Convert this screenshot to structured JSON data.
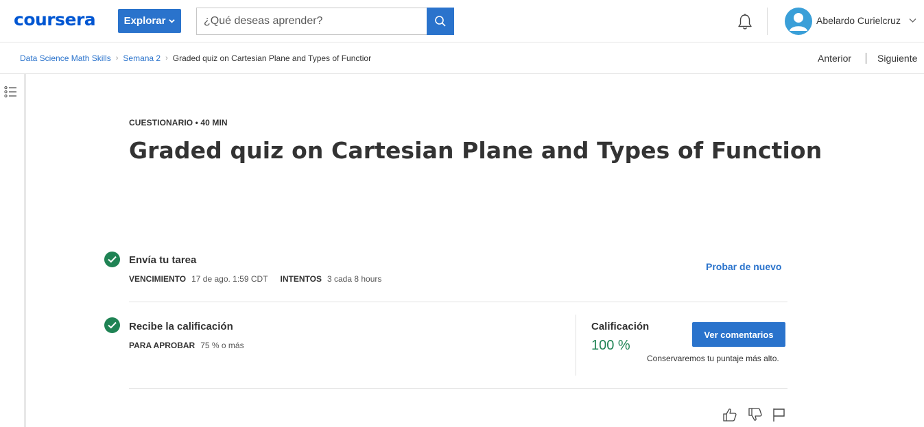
{
  "header": {
    "logo": "coursera",
    "explore_label": "Explorar",
    "search_placeholder": "¿Qué deseas aprender?",
    "user_name": "Abelardo Curielcruz",
    "icons": [
      "chevron-down-icon",
      "search-icon",
      "bell-icon",
      "avatar-user-icon"
    ]
  },
  "breadcrumb": {
    "items": [
      "Data Science Math Skills",
      "Semana 2",
      "Graded quiz on Cartesian Plane and Types of Functior"
    ],
    "separator": "›"
  },
  "nav": {
    "prev": "Anterior",
    "next": "Siguiente"
  },
  "quiz": {
    "kicker": "CUESTIONARIO • 40 MIN",
    "title": "Graded quiz on Cartesian Plane and Types of Function"
  },
  "submit": {
    "title": "Envía tu tarea",
    "due_label": "VENCIMIENTO",
    "due_value": "17 de ago. 1:59 CDT",
    "attempts_label": "INTENTOS",
    "attempts_value": "3 cada 8 hours",
    "retry": "Probar de nuevo"
  },
  "grade": {
    "title": "Recibe la calificación",
    "pass_label": "PARA APROBAR",
    "pass_value": "75 % o más",
    "label": "Calificación",
    "value": "100 %",
    "feedback_button": "Ver comentarios",
    "note": "Conservaremos tu puntaje más alto."
  },
  "colors": {
    "brand": "#0056d2",
    "primary": "#2a73cc",
    "success": "#1f8354",
    "text": "#333333"
  }
}
